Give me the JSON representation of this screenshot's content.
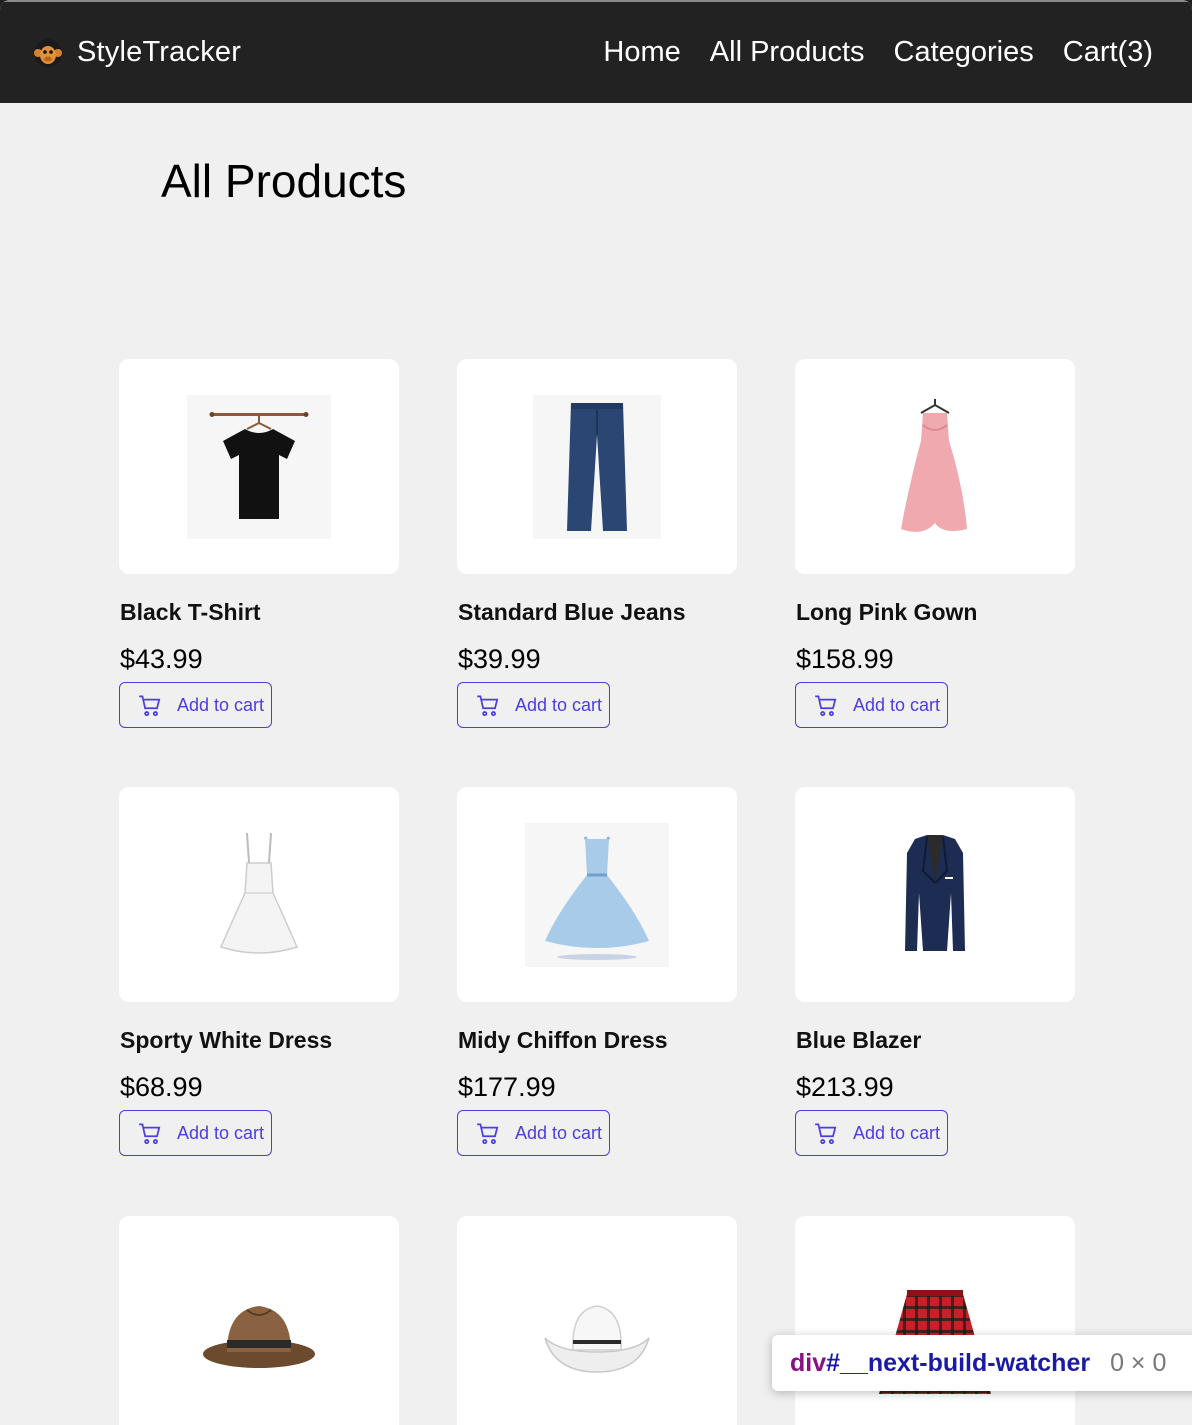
{
  "header": {
    "brand": "StyleTracker",
    "logo_icon": "monkey-face-icon",
    "nav": [
      {
        "label": "Home"
      },
      {
        "label": "All Products"
      },
      {
        "label": "Categories"
      },
      {
        "label": "Cart(3)"
      }
    ]
  },
  "page": {
    "title": "All Products"
  },
  "button_label": "Add to cart",
  "products": [
    {
      "name": "Black T-Shirt",
      "price": "$43.99",
      "image_icon": "black-tshirt-on-hanger-icon"
    },
    {
      "name": "Standard Blue Jeans",
      "price": "$39.99",
      "image_icon": "blue-jeans-icon"
    },
    {
      "name": "Long Pink Gown",
      "price": "$158.99",
      "image_icon": "pink-gown-icon"
    },
    {
      "name": "Sporty White Dress",
      "price": "$68.99",
      "image_icon": "white-dress-icon"
    },
    {
      "name": "Midy Chiffon Dress",
      "price": "$177.99",
      "image_icon": "light-blue-dress-icon"
    },
    {
      "name": "Blue Blazer",
      "price": "$213.99",
      "image_icon": "navy-blazer-icon"
    },
    {
      "image_icon": "brown-fedora-hat-icon"
    },
    {
      "image_icon": "white-cowboy-hat-icon"
    },
    {
      "image_icon": "red-plaid-skirt-icon"
    }
  ],
  "devtools": {
    "tag": "div",
    "id": "#__next-build-watcher",
    "dimensions": "0 × 0"
  },
  "colors": {
    "navbar": "#222222",
    "page_bg": "#f0f0f0",
    "accent": "#4a3ee0"
  }
}
